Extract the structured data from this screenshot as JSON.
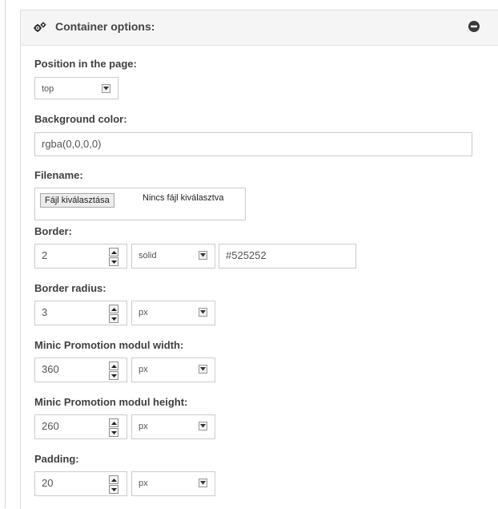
{
  "panel": {
    "title": "Container options:",
    "header_icon": "gears-icon",
    "collapse_icon": "minus-circle-icon"
  },
  "fields": {
    "position": {
      "label": "Position in the page:",
      "value": "top"
    },
    "background": {
      "label": "Background color:",
      "value": "rgba(0,0,0,0)"
    },
    "filename": {
      "label": "Filename:",
      "button": "Fájl kiválasztása",
      "status": "Nincs fájl kiválasztva"
    },
    "border": {
      "label": "Border:",
      "width": "2",
      "style": "solid",
      "color": "#525252"
    },
    "border_radius": {
      "label": "Border radius:",
      "value": "3",
      "unit": "px"
    },
    "modul_width": {
      "label": "Minic Promotion modul width:",
      "value": "360",
      "unit": "px"
    },
    "modul_height": {
      "label": "Minic Promotion modul height:",
      "value": "260",
      "unit": "px"
    },
    "padding": {
      "label": "Padding:",
      "value": "20",
      "unit": "px"
    }
  },
  "colors": {
    "header_bg": "#f5f5f5",
    "border": "#cccccc",
    "text": "#404040"
  }
}
